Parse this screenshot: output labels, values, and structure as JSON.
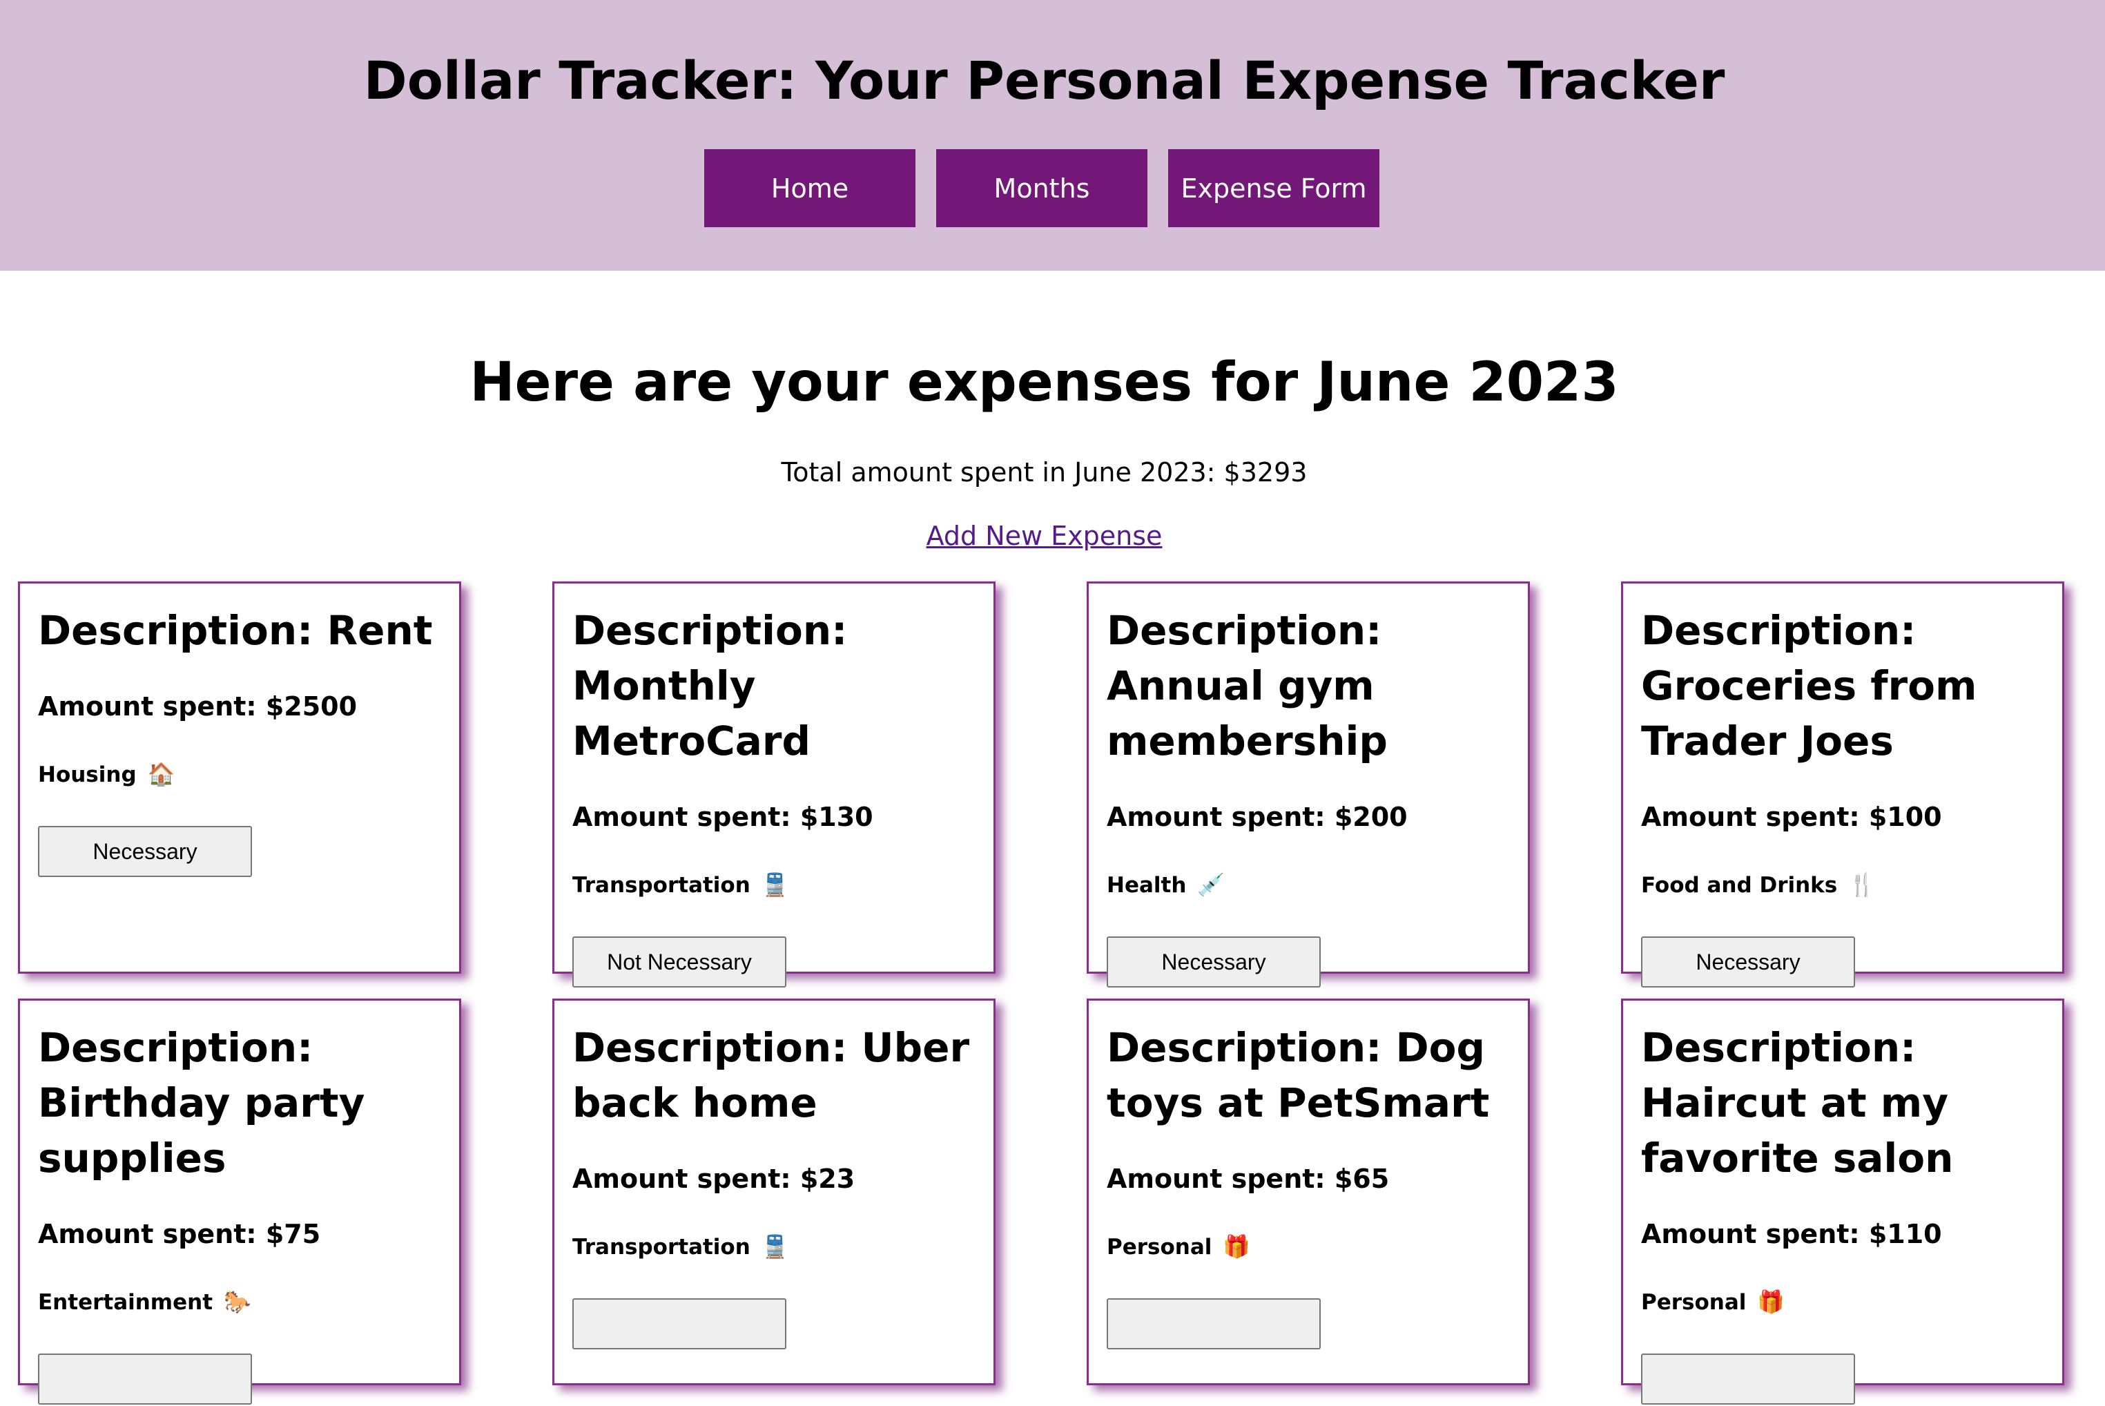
{
  "header": {
    "title": "Dollar Tracker: Your Personal Expense Tracker",
    "nav": [
      "Home",
      "Months",
      "Expense Form"
    ]
  },
  "main": {
    "heading": "Here are your expenses for June 2023",
    "total_text": "Total amount spent in June 2023: $3293",
    "add_link": "Add New Expense"
  },
  "expenses": [
    {
      "description": "Description: Rent",
      "amount": "Amount spent: $2500",
      "category": "Housing",
      "icon": "🏠",
      "status": "Necessary"
    },
    {
      "description": "Description: Monthly MetroCard",
      "amount": "Amount spent: $130",
      "category": "Transportation",
      "icon": "🚆",
      "status": "Not Necessary"
    },
    {
      "description": "Description: Annual gym membership",
      "amount": "Amount spent: $200",
      "category": "Health",
      "icon": "💉",
      "status": "Necessary"
    },
    {
      "description": "Description: Groceries from Trader Joes",
      "amount": "Amount spent: $100",
      "category": "Food and Drinks",
      "icon": "🍴",
      "status": "Necessary"
    },
    {
      "description": "Description: Birthday party supplies",
      "amount": "Amount spent: $75",
      "category": "Entertainment",
      "icon": "🐎",
      "status": ""
    },
    {
      "description": "Description: Uber back home",
      "amount": "Amount spent: $23",
      "category": "Transportation",
      "icon": "🚆",
      "status": ""
    },
    {
      "description": "Description: Dog toys at PetSmart",
      "amount": "Amount spent: $65",
      "category": "Personal",
      "icon": "🎁",
      "status": ""
    },
    {
      "description": "Description: Haircut at my favorite salon",
      "amount": "Amount spent: $110",
      "category": "Personal",
      "icon": "🎁",
      "status": ""
    }
  ],
  "colors": {
    "header_bg": "#d4bfd6",
    "nav_button": "#731878",
    "card_border": "#8b2c8f",
    "link": "#551a8b"
  }
}
